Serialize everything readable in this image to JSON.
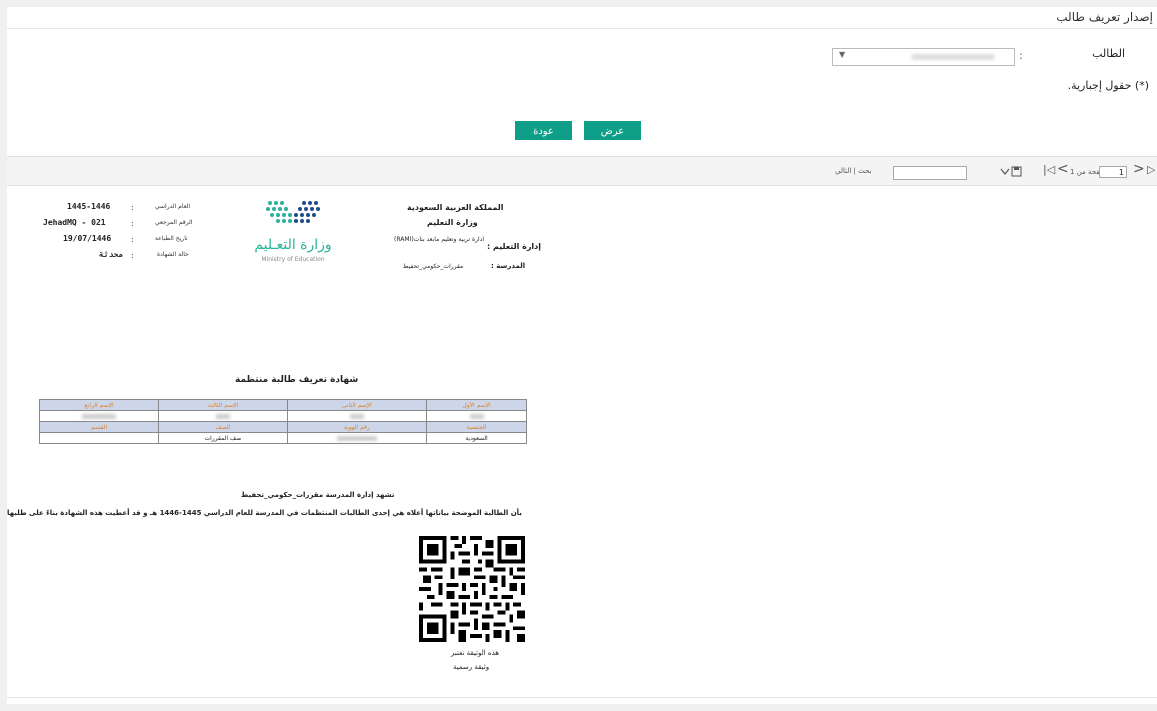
{
  "header": {
    "breadcrumb": "إصدار تعريف طالب"
  },
  "form": {
    "student_label": "الطالب",
    "colon": ":",
    "select_arrow": "▼",
    "required_note": "(*) حقول إجبارية.",
    "show_button": "عرض",
    "back_button": "عودة"
  },
  "toolbar": {
    "find_label": "بحث | التالي",
    "page_value": "1",
    "page_of": "صفحة من 1"
  },
  "report": {
    "org": {
      "country": "المملكة العربية السعودية",
      "ministry": "وزارة التعليم",
      "edu_admin_label": "إدارة التعليم :",
      "edu_admin_value": "ادارة تربية وتعليم مابعد بنات(RAMI)",
      "school_label": "المدرسة :",
      "school_value": "مقررات_حكومي_تحفيظ"
    },
    "logo": {
      "arabic": "وزارة التعـليم",
      "english": "Ministry of Education"
    },
    "meta": [
      {
        "label": "العام الدراسي",
        "value": "1445-1446"
      },
      {
        "label": "الرقم المرجعي",
        "value": "JehadMQ - 021"
      },
      {
        "label": "تاريخ الطباعة",
        "value": "19/07/1446"
      },
      {
        "label": "حالة الشهادة",
        "value": "محدثة"
      }
    ],
    "meta_colon": ":",
    "cert_title": "شهادة تعريف طالبة منتظمة",
    "table": {
      "headers1": [
        "الإسم الأول",
        "الإسم الثاني",
        "الإسم الثالث",
        "الإسم الرابع"
      ],
      "headers2": [
        "الجنسية",
        "رقم الهوية",
        "الصف",
        "القسم"
      ],
      "row2": [
        "السعودية",
        "",
        "صف المقررات",
        ""
      ]
    },
    "para1": "تشهد إدارة المدرسة مقررات_حكومي_تحفيظ",
    "para2": "بأن الطالبة الموضحة بياناتها أعلاه هي إحدى الطالبات المنتظمات في المدرسة للعام الدراسي  1445-1446 هـ و قد أعطيت هذه الشهادة بناءً على طلبها",
    "qr_caption1": "هذه الوثيقة تعتبر",
    "qr_caption2": "وثيقة رسمية"
  },
  "colors": {
    "accent": "#0f9e87",
    "table_header_bg": "#cdd6e8",
    "table_header_text": "#d9822b",
    "logo_green": "#2bb29a",
    "logo_blue": "#1f4e8c"
  }
}
